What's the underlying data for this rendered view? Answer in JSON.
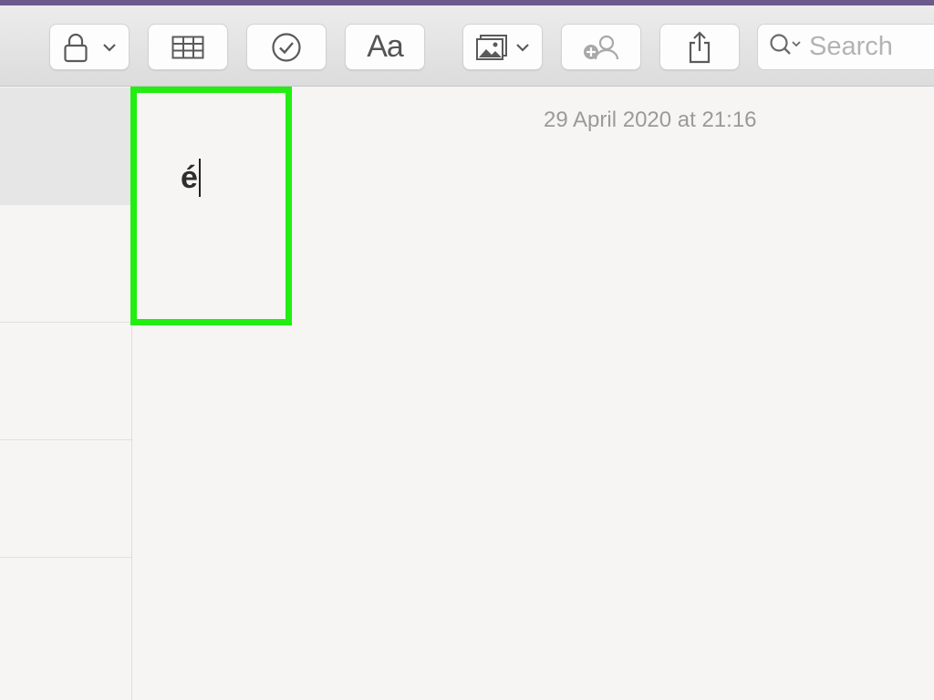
{
  "toolbar": {
    "buttons": [
      {
        "name": "lock-button",
        "icon": "lock-icon",
        "has_dropdown": true
      },
      {
        "name": "table-button",
        "icon": "table-icon"
      },
      {
        "name": "checklist-button",
        "icon": "checkmark-circle-icon"
      },
      {
        "name": "format-button",
        "icon": "text-format-icon",
        "label": "Aa"
      },
      {
        "name": "media-button",
        "icon": "photo-icon",
        "has_dropdown": true
      },
      {
        "name": "collaborate-button",
        "icon": "add-people-icon",
        "disabled": true
      },
      {
        "name": "share-button",
        "icon": "share-icon"
      }
    ],
    "search": {
      "placeholder": "Search",
      "icon": "search-icon"
    }
  },
  "note": {
    "date": "29 April 2020 at 21:16",
    "text": "é"
  },
  "highlight": {
    "color": "#22ee11"
  },
  "colors": {
    "window_accent": "#6b5a8c",
    "background": "#f6f5f3",
    "sidebar_selected": "#e6e6e6"
  }
}
